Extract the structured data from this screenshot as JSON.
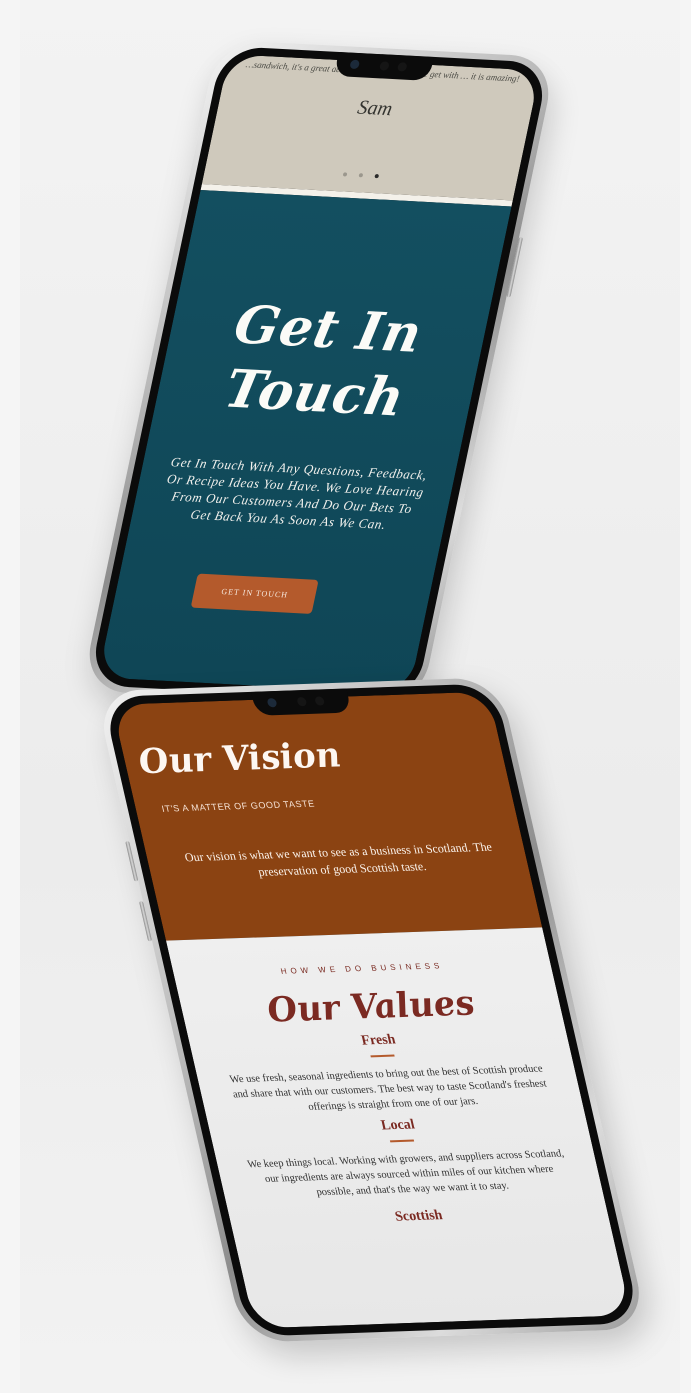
{
  "phone1": {
    "testimonial_quote": "…sandwich, it's a great accompaniment… what we get with … it is amazing!",
    "testimonial_name": "Sam",
    "dots": [
      false,
      false,
      true
    ],
    "contact": {
      "heading_line1": "Get In",
      "heading_line2": "Touch",
      "body": "Get In Touch With Any Questions, Feedback, Or Recipe Ideas You Have.  We Love Hearing From Our Customers And Do Our Bets To Get Back You As Soon As We Can.",
      "button_label": "GET IN TOUCH"
    }
  },
  "phone2": {
    "vision": {
      "title": "Our Vision",
      "subtitle": "IT'S A MATTER OF GOOD TASTE",
      "body": "Our vision is what we want to see as a business in Scotland. The preservation of good Scottish taste."
    },
    "values": {
      "eyebrow": "HOW WE DO BUSINESS",
      "title": "Our Values",
      "items": [
        {
          "title": "Fresh",
          "text": "We use fresh, seasonal ingredients to bring out the best of Scottish produce and share that with our customers. The best way to taste Scotland's freshest offerings is straight from one of our jars."
        },
        {
          "title": "Local",
          "text": "We keep things local. Working with growers, and suppliers across Scotland, our ingredients are always sourced within miles of our kitchen where possible, and that's the way we want it to stay."
        },
        {
          "title": "Scottish",
          "text": ""
        }
      ]
    }
  },
  "colors": {
    "contact_bg": "#134f60",
    "button_bg": "#b45a2c",
    "vision_bg": "#8b4312",
    "values_accent": "#7b2a22",
    "testimonial_bg": "#cfc9bc"
  }
}
